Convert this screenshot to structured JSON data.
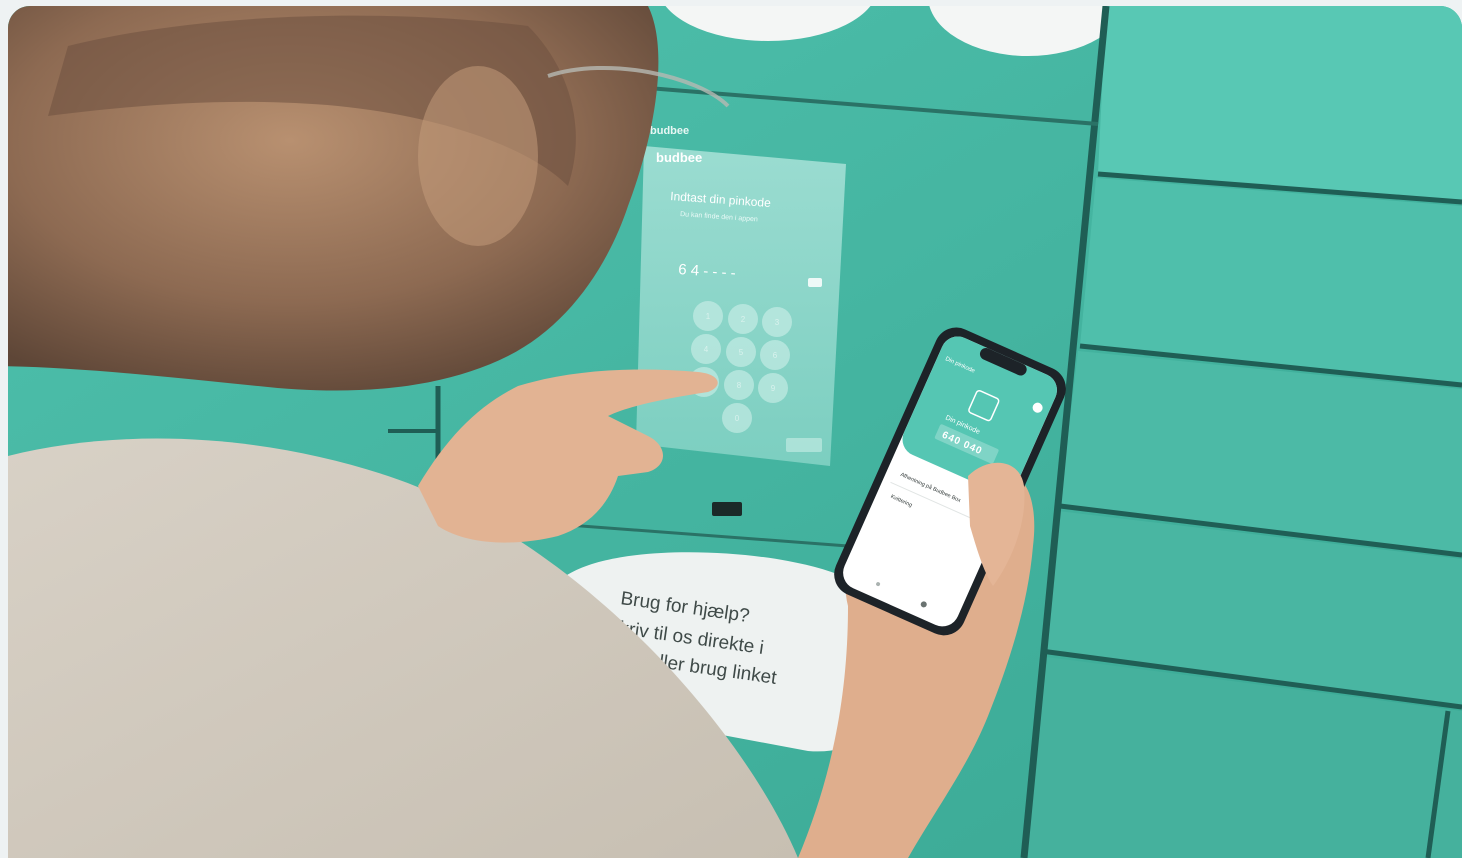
{
  "photo": {
    "subject": "person-entering-pin-at-parcel-locker",
    "colors": {
      "locker_teal": "#46b9a5",
      "locker_teal_light": "#5cc9b6",
      "seam": "#1f5e55",
      "shirt": "#d9d2c7",
      "skin": "#e2b393"
    }
  },
  "kiosk": {
    "brand_top": "budbee",
    "brand": "budbee",
    "title": "Indtast din pinkode",
    "subtitle": "Du kan finde den i appen",
    "pin_display": "6 4 -  -  -  -",
    "keypad_keys": [
      "1",
      "2",
      "3",
      "4",
      "5",
      "6",
      "7",
      "8",
      "9",
      "0"
    ]
  },
  "sticker": {
    "line1": "Brug for hjælp?",
    "line2": "Skriv til os direkte i",
    "line3": "eller brug linket"
  },
  "phone": {
    "header": "Din pinkode",
    "pin_label": "Din pinkode",
    "pin_code": "640 040",
    "row1": "Afhentning på Budbee Box",
    "row2": "Kvittering"
  }
}
